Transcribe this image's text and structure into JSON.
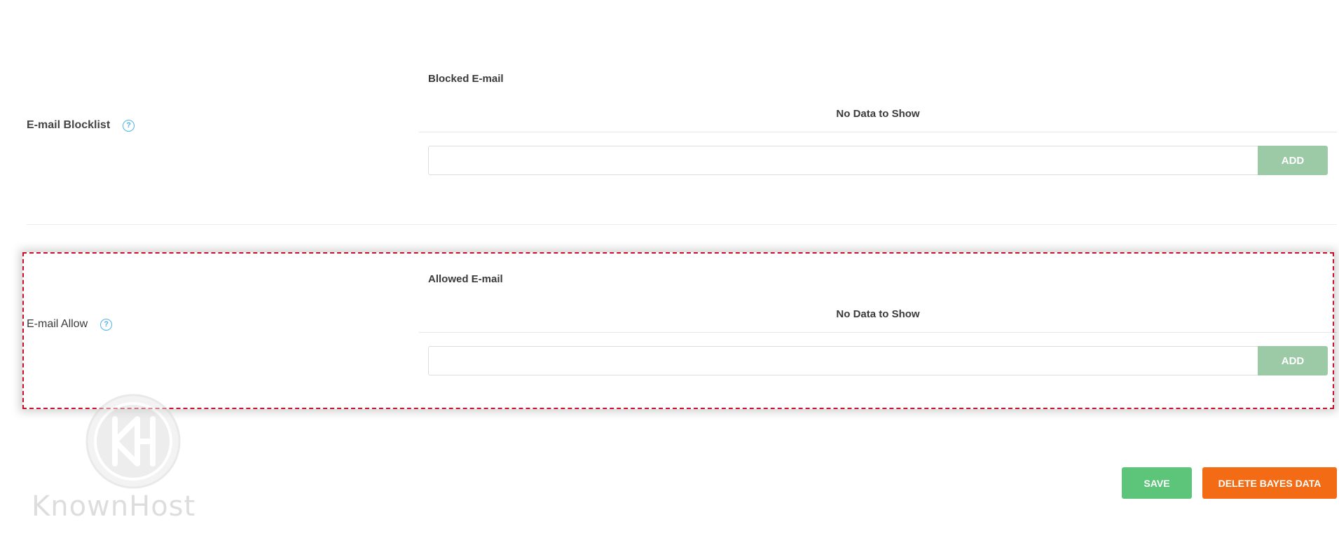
{
  "blocklist": {
    "label": "E-mail Blocklist",
    "help_icon": "question-circle-icon",
    "column_header": "Blocked E-mail",
    "empty_message": "No Data to Show",
    "input_value": "",
    "add_label": "ADD"
  },
  "allowlist": {
    "label": "E-mail Allow",
    "help_icon": "question-circle-icon",
    "column_header": "Allowed E-mail",
    "empty_message": "No Data to Show",
    "input_value": "",
    "add_label": "ADD"
  },
  "actions": {
    "save_label": "SAVE",
    "delete_bayes_label": "DELETE BAYES DATA"
  },
  "watermark": {
    "brand_text": "KnownHost"
  },
  "colors": {
    "help_icon": "#4fb3e8",
    "add_button": "#9ccaa6",
    "save_button": "#5cc57a",
    "delete_button": "#f36c15",
    "highlight_border": "#c8102e"
  }
}
